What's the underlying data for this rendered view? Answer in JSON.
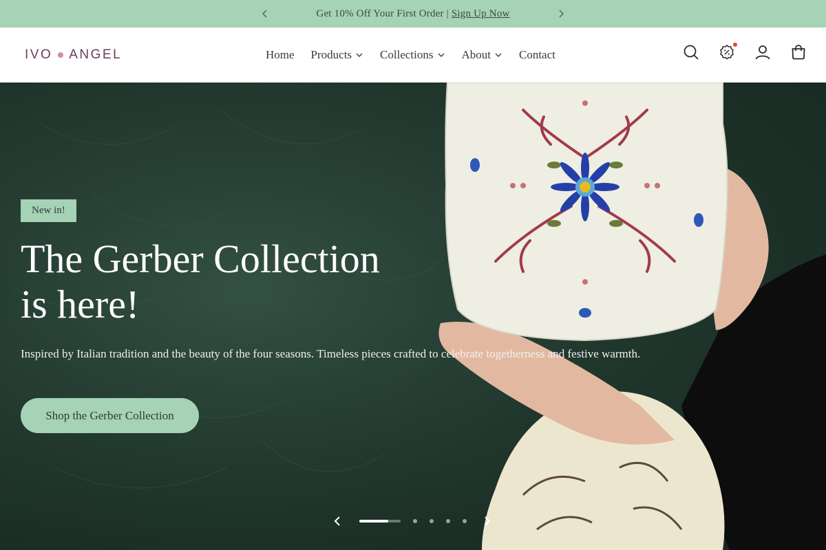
{
  "announcement": {
    "text": "Get 10% Off Your First Order |",
    "link": "Sign Up Now"
  },
  "header": {
    "logo_left": "IVO",
    "logo_right": "ANGEL",
    "nav": [
      {
        "label": "Home",
        "dropdown": false
      },
      {
        "label": "Products",
        "dropdown": true
      },
      {
        "label": "Collections",
        "dropdown": true
      },
      {
        "label": "About",
        "dropdown": true
      },
      {
        "label": "Contact",
        "dropdown": false
      }
    ],
    "icons": [
      "search-icon",
      "discount-icon",
      "account-icon",
      "cart-icon"
    ]
  },
  "hero": {
    "badge": "New in!",
    "title_line1": "The Gerber Collection",
    "title_line2": "is here!",
    "description": "Inspired by Italian tradition and the beauty of the four seasons. Timeless pieces crafted to celebrate togetherness and festive warmth.",
    "cta": "Shop the Gerber Collection",
    "slide_count": 5,
    "current_slide": 1,
    "slide_progress": 0.7
  },
  "colors": {
    "accent": "#a6d2b6",
    "brand": "#6b3b5e",
    "brand_dot": "#d58ba8",
    "hero_bg": "#223a30"
  }
}
